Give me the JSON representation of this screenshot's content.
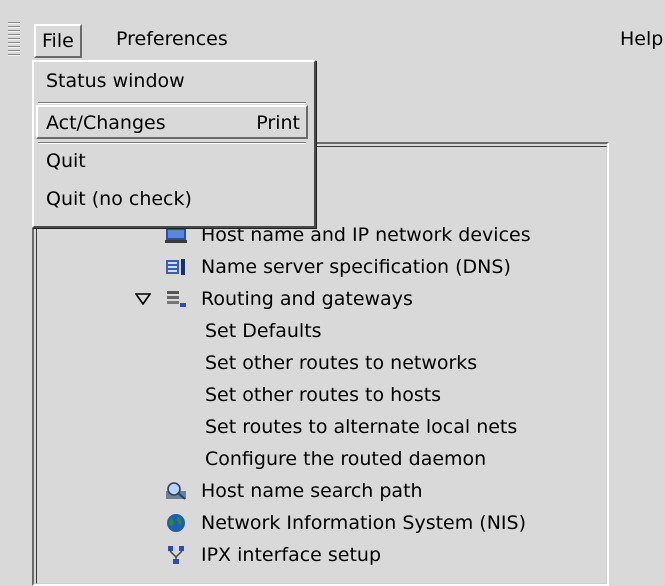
{
  "menubar": {
    "file": "File",
    "preferences": "Preferences",
    "help": "Help"
  },
  "file_menu": {
    "items": [
      {
        "label": "Status window"
      },
      {
        "label": "Act/Changes",
        "accel": "Print"
      },
      {
        "label": "Quit"
      },
      {
        "label": "Quit (no check)"
      }
    ]
  },
  "tree": {
    "items": [
      {
        "label": "Host name and IP network devices",
        "icon": "network-card-icon"
      },
      {
        "label": "Name server specification (DNS)",
        "icon": "dns-server-icon"
      },
      {
        "label": "Routing and gateways",
        "icon": "router-icon",
        "expanded": true
      },
      {
        "label": "Set Defaults"
      },
      {
        "label": "Set other routes to networks"
      },
      {
        "label": "Set other routes to hosts"
      },
      {
        "label": "Set routes to alternate local nets"
      },
      {
        "label": "Configure the routed daemon"
      },
      {
        "label": "Host name search path",
        "icon": "search-path-icon"
      },
      {
        "label": "Network Information System (NIS)",
        "icon": "globe-icon"
      },
      {
        "label": "IPX interface setup",
        "icon": "ipx-network-icon"
      }
    ]
  },
  "colors": {
    "background": "#d9d9d9",
    "bevel_light": "#ffffff",
    "bevel_dark": "#6a6a6a"
  }
}
